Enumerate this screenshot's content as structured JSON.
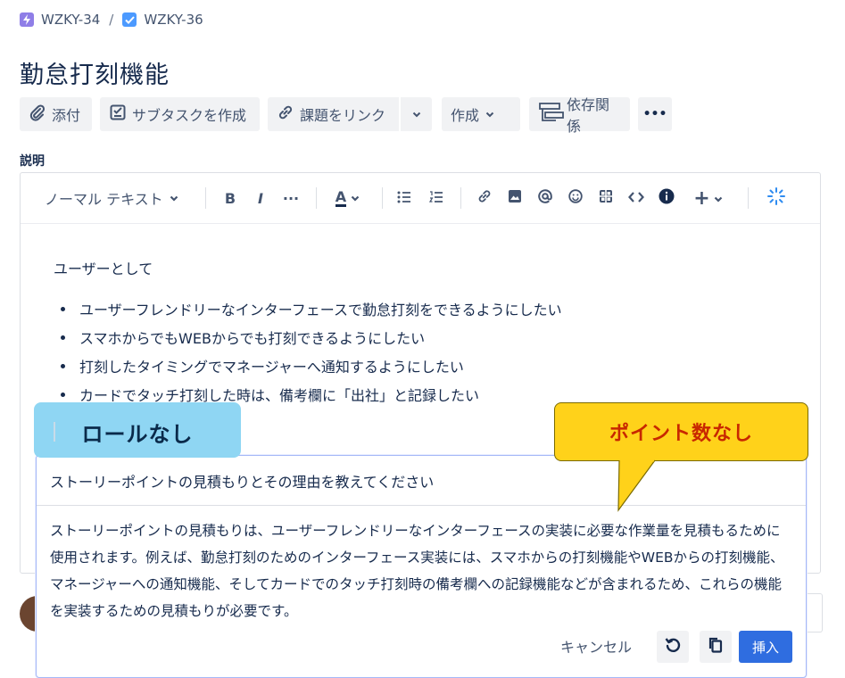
{
  "breadcrumb": {
    "parent_key": "WZKY-34",
    "separator": "/",
    "issue_key": "WZKY-36"
  },
  "issue": {
    "title": "勤怠打刻機能"
  },
  "actions": {
    "attach": "添付",
    "subtask": "サブタスクを作成",
    "link": "課題をリンク",
    "create": "作成",
    "dependency": "依存関係",
    "more": "•••"
  },
  "description": {
    "label": "説明",
    "toolbar": {
      "text_style": "ノーマル テキスト",
      "bold": "B",
      "italic": "I",
      "more": "···",
      "color": "A",
      "plus": "+"
    },
    "intro": "ユーザーとして",
    "bullets": [
      "ユーザーフレンドリーなインターフェースで勤怠打刻をできるようにしたい",
      "スマホからでもWEBからでも打刻できるようにしたい",
      "打刻したタイミングでマネージャーへ通知するようにしたい",
      "カードでタッチ打刻した時は、備考欄に「出社」と記録したい"
    ]
  },
  "ai_panel": {
    "question": "ストーリーポイントの見積もりとその理由を教えてください",
    "answer": "ストーリーポイントの見積もりは、ユーザーフレンドリーなインターフェースの実装に必要な作業量を見積もるために使用されます。例えば、勤怠打刻のためのインターフェース実装には、スマホからの打刻機能やWEBからの打刻機能、マネージャーへの通知機能、そしてカードでのタッチ打刻時の備考欄への記録機能などが含まれるため、これらの機能を実装するための見積もりが必要です。",
    "cancel": "キャンセル",
    "insert": "挿入"
  },
  "callouts": {
    "left": "ロールなし",
    "right": "ポイント数なし"
  },
  "colors": {
    "accent": "#2f6de0",
    "callout_blue": "#8fd6f3",
    "callout_yellow": "#ffd21a",
    "callout_red_text": "#c82700"
  }
}
